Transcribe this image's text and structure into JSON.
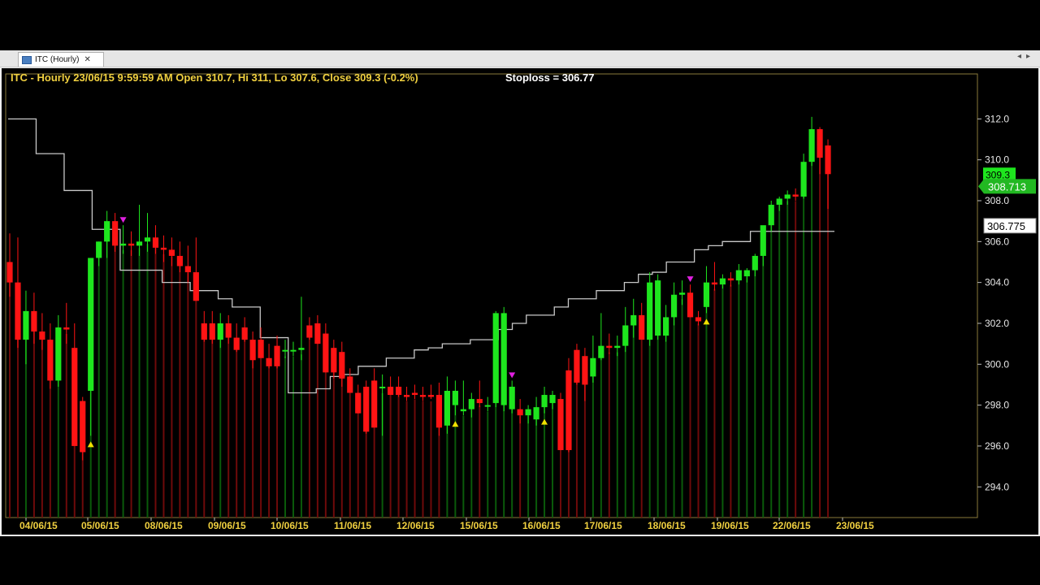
{
  "window": {
    "tab_label": "ITC (Hourly)",
    "close_glyph": "✕",
    "nav_prev": "◂",
    "nav_next": "▸"
  },
  "colors": {
    "up": "#1ee61e",
    "down": "#ff1414",
    "up_volume": "#0a5a0a",
    "down_volume": "#6e0a0a",
    "stoploss": "#c8c8c8",
    "frame": "#8a7a3a",
    "header_text": "#f0d040",
    "buy_marker": "#f0e000",
    "sell_marker": "#e020e0"
  },
  "chart_data": {
    "type": "candlestick",
    "title": "ITC - Hourly 23/06/15 9:59:59 AM Open 310.7, Hi 311, Lo 307.6, Close 309.3 (-0.2%)",
    "stoploss_text": "Stoploss = 306.77",
    "ylim": [
      292.5,
      314.2
    ],
    "y_ticks": [
      "294.0",
      "296.0",
      "298.0",
      "300.0",
      "302.0",
      "304.0",
      "306.0",
      "308.0",
      "310.0",
      "312.0"
    ],
    "dates": [
      "04/06/15",
      "05/06/15",
      "08/06/15",
      "09/06/15",
      "10/06/15",
      "11/06/15",
      "12/06/15",
      "15/06/15",
      "16/06/15",
      "17/06/15",
      "18/06/15",
      "19/06/15",
      "22/06/15",
      "23/06/15"
    ],
    "price_labels": [
      {
        "text": "309.3",
        "value": 309.3,
        "style": "up"
      },
      {
        "text": "308.713",
        "value": 308.7,
        "style": "up-arrow"
      },
      {
        "text": "306.775",
        "value": 306.775,
        "style": "stoploss"
      }
    ],
    "candles": [
      [
        305.0,
        306.4,
        303.3,
        304.0
      ],
      [
        304.0,
        306.2,
        300.8,
        301.2
      ],
      [
        301.2,
        303.6,
        300.0,
        302.6
      ],
      [
        302.6,
        303.5,
        301.0,
        301.6
      ],
      [
        301.6,
        302.5,
        300.7,
        301.2
      ],
      [
        301.2,
        302.0,
        298.8,
        299.2
      ],
      [
        299.2,
        302.4,
        298.9,
        301.8
      ],
      [
        301.8,
        303.0,
        301.0,
        301.7
      ],
      [
        300.8,
        302.0,
        297.7,
        296.0
      ],
      [
        298.2,
        298.4,
        295.3,
        295.7
      ],
      [
        298.7,
        299.5,
        296.5,
        305.2
      ],
      [
        305.2,
        306.0,
        304.8,
        306.0
      ],
      [
        306.0,
        307.5,
        305.2,
        307.0
      ],
      [
        307.0,
        307.4,
        305.5,
        305.8
      ],
      [
        305.8,
        306.8,
        305.4,
        305.9
      ],
      [
        305.9,
        306.5,
        305.3,
        305.8
      ],
      [
        305.8,
        307.8,
        305.3,
        306.0
      ],
      [
        306.0,
        307.4,
        305.5,
        306.2
      ],
      [
        306.2,
        306.8,
        305.4,
        305.7
      ],
      [
        305.7,
        306.3,
        305.0,
        305.6
      ],
      [
        305.6,
        306.2,
        304.8,
        305.3
      ],
      [
        305.3,
        306.0,
        304.5,
        304.8
      ],
      [
        304.8,
        305.8,
        304.0,
        304.5
      ],
      [
        304.5,
        306.2,
        303.2,
        303.1
      ],
      [
        302.0,
        302.6,
        301.1,
        301.2
      ],
      [
        302.0,
        302.6,
        301.0,
        301.2
      ],
      [
        301.2,
        302.5,
        300.8,
        302.0
      ],
      [
        302.0,
        302.4,
        301.0,
        301.3
      ],
      [
        301.3,
        302.0,
        300.6,
        300.7
      ],
      [
        301.8,
        302.3,
        301.1,
        301.2
      ],
      [
        301.2,
        301.6,
        299.8,
        300.2
      ],
      [
        301.2,
        301.8,
        300.5,
        300.3
      ],
      [
        300.3,
        301.0,
        299.8,
        299.9
      ],
      [
        300.9,
        301.4,
        299.8,
        299.9
      ],
      [
        300.7,
        301.2,
        300.3,
        300.7
      ],
      [
        300.7,
        301.1,
        300.4,
        300.7
      ],
      [
        300.7,
        303.3,
        300.2,
        300.8
      ],
      [
        301.9,
        302.3,
        301.2,
        301.3
      ],
      [
        302.0,
        302.4,
        301.0,
        301.0
      ],
      [
        301.5,
        302.0,
        299.6,
        299.6
      ],
      [
        300.8,
        301.2,
        299.3,
        299.6
      ],
      [
        300.6,
        301.1,
        298.9,
        299.3
      ],
      [
        299.4,
        299.8,
        298.6,
        298.6
      ],
      [
        298.6,
        299.0,
        297.6,
        297.6
      ],
      [
        298.9,
        299.2,
        296.6,
        296.7
      ],
      [
        299.2,
        299.8,
        297.0,
        296.9
      ],
      [
        298.9,
        299.5,
        296.5,
        298.9
      ],
      [
        298.9,
        299.4,
        298.5,
        298.5
      ],
      [
        298.9,
        299.4,
        298.4,
        298.5
      ],
      [
        298.5,
        298.9,
        298.2,
        298.4
      ],
      [
        298.6,
        299.0,
        298.3,
        298.5
      ],
      [
        298.5,
        298.9,
        298.2,
        298.4
      ],
      [
        298.5,
        299.0,
        298.3,
        298.4
      ],
      [
        298.5,
        299.1,
        296.5,
        296.9
      ],
      [
        297.0,
        299.4,
        296.6,
        298.7
      ],
      [
        298.0,
        299.2,
        297.5,
        298.7
      ],
      [
        297.7,
        299.2,
        297.5,
        297.8
      ],
      [
        297.8,
        298.6,
        297.4,
        298.3
      ],
      [
        298.3,
        299.2,
        297.9,
        298.1
      ],
      [
        298.0,
        298.4,
        297.7,
        298.0
      ],
      [
        298.1,
        302.6,
        297.9,
        302.5
      ],
      [
        298.0,
        302.8,
        297.7,
        302.5
      ],
      [
        297.8,
        299.2,
        297.6,
        298.9
      ],
      [
        297.8,
        298.3,
        297.1,
        297.5
      ],
      [
        297.5,
        298.0,
        297.1,
        297.8
      ],
      [
        297.3,
        298.4,
        297.0,
        297.9
      ],
      [
        297.9,
        298.9,
        297.6,
        298.5
      ],
      [
        298.1,
        298.7,
        297.8,
        298.5
      ],
      [
        298.3,
        298.6,
        296.0,
        295.8
      ],
      [
        299.7,
        300.3,
        295.7,
        295.8
      ],
      [
        300.7,
        301.0,
        299.0,
        299.1
      ],
      [
        300.4,
        300.8,
        298.2,
        299.0
      ],
      [
        299.4,
        301.4,
        299.1,
        300.3
      ],
      [
        300.3,
        302.5,
        300.2,
        300.9
      ],
      [
        300.9,
        301.5,
        300.5,
        300.8
      ],
      [
        300.8,
        301.4,
        300.4,
        300.9
      ],
      [
        300.9,
        302.8,
        300.6,
        301.9
      ],
      [
        301.9,
        303.2,
        301.3,
        302.4
      ],
      [
        302.4,
        303.0,
        301.7,
        301.2
      ],
      [
        301.2,
        304.5,
        300.9,
        304.0
      ],
      [
        301.4,
        304.4,
        301.2,
        304.1
      ],
      [
        301.4,
        302.9,
        301.1,
        302.3
      ],
      [
        302.3,
        304.0,
        301.9,
        303.4
      ],
      [
        303.4,
        304.1,
        302.9,
        303.5
      ],
      [
        303.5,
        303.9,
        302.3,
        302.3
      ],
      [
        302.3,
        302.6,
        301.9,
        302.1
      ],
      [
        302.8,
        304.8,
        302.5,
        304.0
      ],
      [
        304.0,
        305.0,
        303.6,
        303.9
      ],
      [
        303.9,
        304.4,
        303.7,
        304.2
      ],
      [
        304.2,
        304.5,
        303.8,
        304.1
      ],
      [
        304.1,
        304.9,
        303.9,
        304.6
      ],
      [
        304.3,
        304.7,
        304.0,
        304.6
      ],
      [
        304.6,
        305.4,
        304.3,
        305.3
      ],
      [
        305.3,
        306.0,
        304.8,
        306.8
      ],
      [
        306.8,
        308.0,
        306.5,
        307.8
      ],
      [
        307.8,
        308.2,
        307.5,
        308.1
      ],
      [
        308.1,
        308.5,
        307.8,
        308.3
      ],
      [
        308.3,
        308.6,
        308.0,
        308.2
      ],
      [
        308.2,
        310.3,
        308.1,
        309.9
      ],
      [
        309.9,
        312.1,
        309.7,
        311.5
      ],
      [
        311.5,
        311.6,
        309.3,
        310.1
      ],
      [
        310.7,
        311.0,
        307.6,
        309.3
      ]
    ],
    "stoploss": [
      312.0,
      312.0,
      310.3,
      310.3,
      308.5,
      308.5,
      306.6,
      306.6,
      304.6,
      304.6,
      304.6,
      304.0,
      304.0,
      303.6,
      303.6,
      303.2,
      302.8,
      302.8,
      301.3,
      301.3,
      298.6,
      298.6,
      298.8,
      299.4,
      299.5,
      299.9,
      299.9,
      300.3,
      300.3,
      300.7,
      300.8,
      301.0,
      301.0,
      301.2,
      301.2,
      301.7,
      302.0,
      302.4,
      302.4,
      302.8,
      303.2,
      303.2,
      303.6,
      303.6,
      304.0,
      304.4,
      304.5,
      305.0,
      305.0,
      305.6,
      305.8,
      306.0,
      306.0,
      306.5,
      306.5,
      306.5,
      306.5,
      306.5,
      306.5,
      306.5
    ],
    "signals": [
      {
        "candle": 10,
        "type": "buy"
      },
      {
        "candle": 14,
        "type": "sell"
      },
      {
        "candle": 55,
        "type": "buy"
      },
      {
        "candle": 62,
        "type": "sell"
      },
      {
        "candle": 66,
        "type": "buy"
      },
      {
        "candle": 84,
        "type": "sell"
      },
      {
        "candle": 86,
        "type": "buy"
      }
    ]
  }
}
